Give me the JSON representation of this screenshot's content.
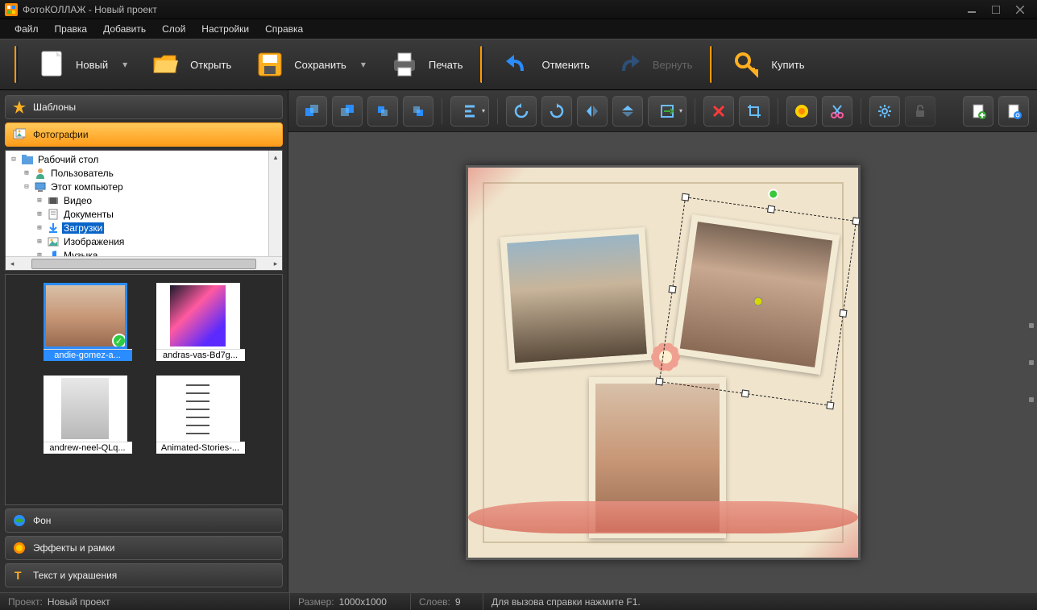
{
  "title": "ФотоКОЛЛАЖ - Новый проект",
  "menu": [
    "Файл",
    "Правка",
    "Добавить",
    "Слой",
    "Настройки",
    "Справка"
  ],
  "toolbar": [
    {
      "label": "Новый",
      "icon": "new",
      "dropdown": true
    },
    {
      "label": "Открыть",
      "icon": "open"
    },
    {
      "label": "Сохранить",
      "icon": "save",
      "dropdown": true
    },
    {
      "label": "Печать",
      "icon": "print"
    },
    {
      "sep": true
    },
    {
      "label": "Отменить",
      "icon": "undo"
    },
    {
      "label": "Вернуть",
      "icon": "redo",
      "disabled": true
    },
    {
      "sep": true
    },
    {
      "label": "Купить",
      "icon": "buy"
    }
  ],
  "accordion": {
    "templates": "Шаблоны",
    "photos": "Фотографии",
    "background": "Фон",
    "effects": "Эффекты и рамки",
    "text": "Текст и украшения"
  },
  "tree": {
    "root": "Рабочий стол",
    "user": "Пользователь",
    "computer": "Этот компьютер",
    "folders": [
      "Видео",
      "Документы",
      "Загрузки",
      "Изображения",
      "Музыка"
    ],
    "selected": "Загрузки"
  },
  "thumbs": [
    {
      "caption": "andie-gomez-a...",
      "selected": true,
      "checked": true
    },
    {
      "caption": "andras-vas-Bd7g..."
    },
    {
      "caption": "andrew-neel-QLq..."
    },
    {
      "caption": "Animated-Stories-..."
    }
  ],
  "status": {
    "project_label": "Проект:",
    "project_value": "Новый проект",
    "size_label": "Размер:",
    "size_value": "1000x1000",
    "layers_label": "Слоев:",
    "layers_value": "9",
    "hint": "Для вызова справки нажмите F1."
  }
}
